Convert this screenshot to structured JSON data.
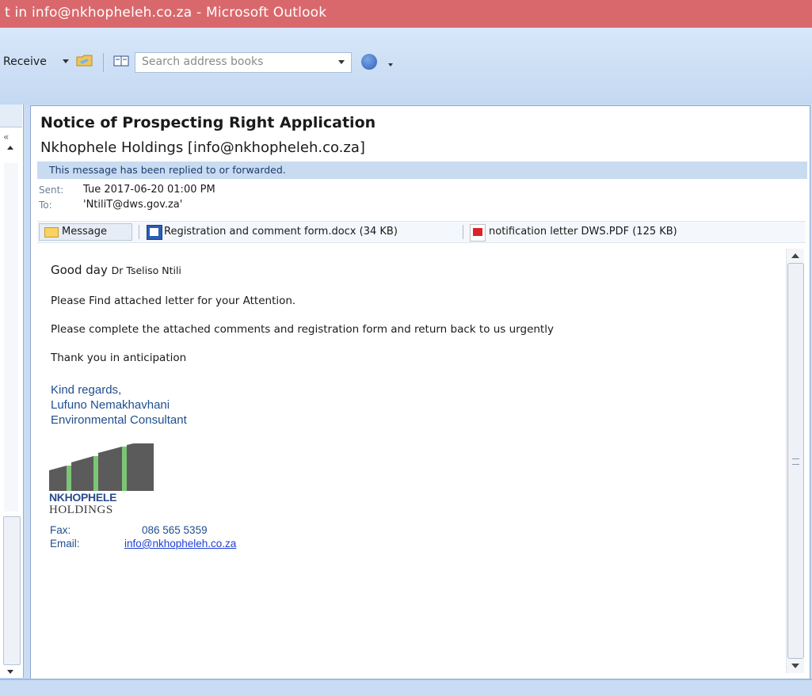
{
  "window": {
    "title": "t in info@nkhopheleh.co.za - Microsoft Outlook"
  },
  "toolbar": {
    "receive_label": "Receive",
    "search_placeholder": "Search address books",
    "icons": [
      "send-receive-dropdown",
      "folder-icon",
      "address-book-icon",
      "help-icon"
    ]
  },
  "message": {
    "subject": "Notice of Prospecting Right Application",
    "sender": "Nkhophele Holdings [info@nkhopheleh.co.za]",
    "info_bar": "This message has been replied to or forwarded.",
    "sent_label": "Sent:",
    "sent_value": "Tue 2017-06-20 01:00 PM",
    "to_label": "To:",
    "to_value": "'NtiliT@dws.gov.za'",
    "attachments": [
      {
        "label": "Message",
        "icon": "envelope-icon"
      },
      {
        "label": "Registration and comment form.docx (34 KB)",
        "icon": "word-doc-icon"
      },
      {
        "label": "notification letter DWS.PDF (125 KB)",
        "icon": "pdf-icon"
      }
    ]
  },
  "body": {
    "greeting": "Good day",
    "greeting_name": "Dr Tseliso Ntili",
    "line1": "Please Find attached letter for your Attention.",
    "line2": "Please complete the attached comments and registration form and return back to us urgently",
    "line3": "Thank you in anticipation",
    "sig_regards": "Kind regards,",
    "sig_name": "Lufuno Nemakhavhani",
    "sig_title": "Environmental Consultant",
    "logo_line1": "NKHOPHELE",
    "logo_line2": "HOLDINGS",
    "fax_label": "Fax:",
    "fax_value": "086 565 5359",
    "email_label": "Email:",
    "email_value": "info@nkhopheleh.co.za"
  },
  "colors": {
    "titlebar": "#d9686c",
    "chrome": "#c9dcf3",
    "info_bar": "#c8dbf1",
    "signature": "#1f4e8e",
    "link": "#1e3fd6",
    "logo_dark": "#5b5b5b",
    "logo_green": "#7cc576"
  }
}
